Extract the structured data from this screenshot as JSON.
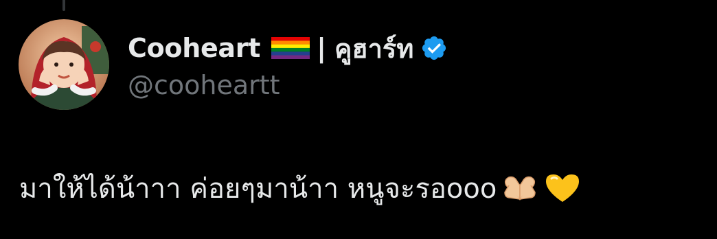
{
  "tweet": {
    "author": {
      "display_name": "Cooheart",
      "separator": "|",
      "thai_name": "คูฮาร์ท",
      "handle": "@cooheartt",
      "flag_icon": "rainbow-flag-icon",
      "verified_icon": "verified-badge-icon",
      "verified_color": "#1d9bf0",
      "avatar": "profile-photo"
    },
    "text": "มาให้ได้น้าาา ค่อยๆมาน้าา หนูจะรอooo",
    "emojis": [
      "heart-hands-emoji",
      "yellow-heart-emoji"
    ]
  },
  "colors": {
    "background": "#000000",
    "text_primary": "#e7e9ea",
    "text_secondary": "#71767b",
    "accent": "#1d9bf0"
  }
}
